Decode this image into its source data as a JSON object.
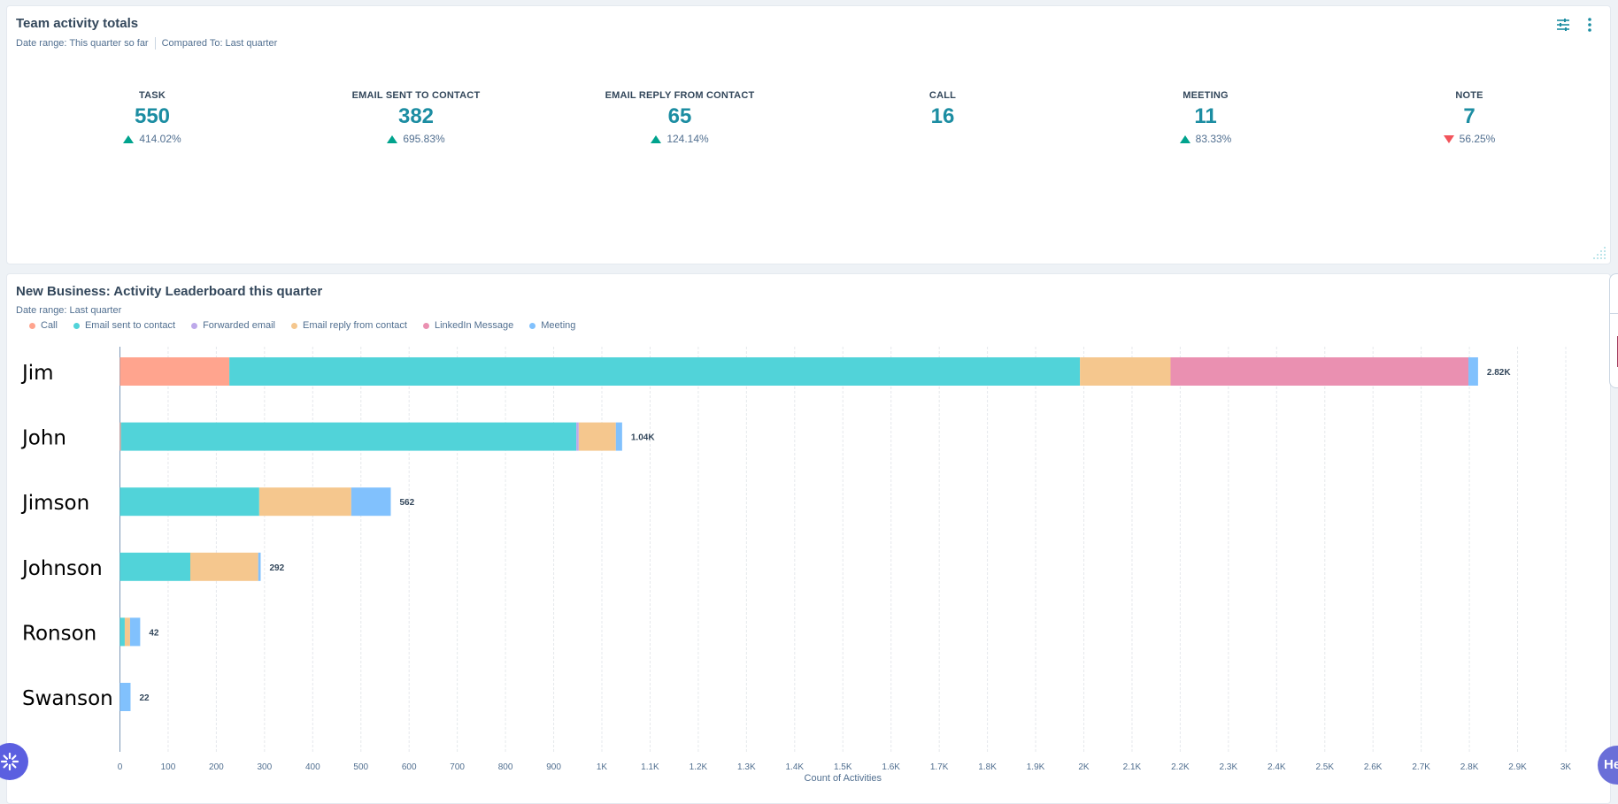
{
  "card_activity_totals": {
    "title": "Team activity totals",
    "date_range": "Date range: This quarter so far",
    "compared_to": "Compared To: Last quarter",
    "actions": {
      "filter_icon": "sliders-icon",
      "menu_icon": "more-vertical-icon"
    },
    "kpis": [
      {
        "label": "TASK",
        "value": "550",
        "change": "414.02%",
        "direction": "up"
      },
      {
        "label": "EMAIL SENT TO CONTACT",
        "value": "382",
        "change": "695.83%",
        "direction": "up"
      },
      {
        "label": "EMAIL REPLY FROM CONTACT",
        "value": "65",
        "change": "124.14%",
        "direction": "up"
      },
      {
        "label": "CALL",
        "value": "16",
        "change": "",
        "direction": "none"
      },
      {
        "label": "MEETING",
        "value": "11",
        "change": "83.33%",
        "direction": "up"
      },
      {
        "label": "NOTE",
        "value": "7",
        "change": "56.25%",
        "direction": "down"
      }
    ],
    "colors": {
      "value": "#1c8da2",
      "up": "#00a38d",
      "down": "#f2545b"
    }
  },
  "card_leaderboard": {
    "title": "New Business: Activity Leaderboard this quarter",
    "date_range": "Date range: Last quarter"
  },
  "chart_data": {
    "type": "bar",
    "orientation": "horizontal",
    "stacked": true,
    "title": "New Business: Activity Leaderboard this quarter",
    "xlabel": "Count of Activities",
    "ylabel": "",
    "xlim": [
      0,
      3000
    ],
    "grid": true,
    "legend_position": "top-left",
    "categories": [
      "Jim",
      "John",
      "Jimson",
      "Johnson",
      "Ronson",
      "Swanson"
    ],
    "x_ticks": [
      "0",
      "100",
      "200",
      "300",
      "400",
      "500",
      "600",
      "700",
      "800",
      "900",
      "1K",
      "1.1K",
      "1.2K",
      "1.3K",
      "1.4K",
      "1.5K",
      "1.6K",
      "1.7K",
      "1.8K",
      "1.9K",
      "2K",
      "2.1K",
      "2.2K",
      "2.3K",
      "2.4K",
      "2.5K",
      "2.6K",
      "2.7K",
      "2.8K",
      "2.9K",
      "3K"
    ],
    "series": [
      {
        "name": "Call",
        "color": "#ffa48e",
        "values": [
          227,
          2,
          0,
          0,
          0,
          0
        ]
      },
      {
        "name": "Email sent to contact",
        "color": "#51d3d9",
        "values": [
          1765,
          945,
          289,
          146,
          10,
          0
        ]
      },
      {
        "name": "Forwarded email",
        "color": "#bda9ea",
        "values": [
          0,
          5,
          0,
          0,
          0,
          0
        ]
      },
      {
        "name": "Email reply from contact",
        "color": "#f5c78e",
        "values": [
          188,
          77,
          191,
          141,
          11,
          0
        ]
      },
      {
        "name": "LinkedIn Message",
        "color": "#ea90b1",
        "values": [
          618,
          0,
          0,
          0,
          0,
          0
        ]
      },
      {
        "name": "Meeting",
        "color": "#81c1fd",
        "values": [
          20,
          13,
          82,
          5,
          21,
          22
        ]
      }
    ],
    "totals_labels": [
      "2.82K",
      "1.04K",
      "562",
      "292",
      "42",
      "22"
    ]
  },
  "floating": {
    "left_button_icon": "sparkle-icon",
    "help_button_label": "He"
  }
}
